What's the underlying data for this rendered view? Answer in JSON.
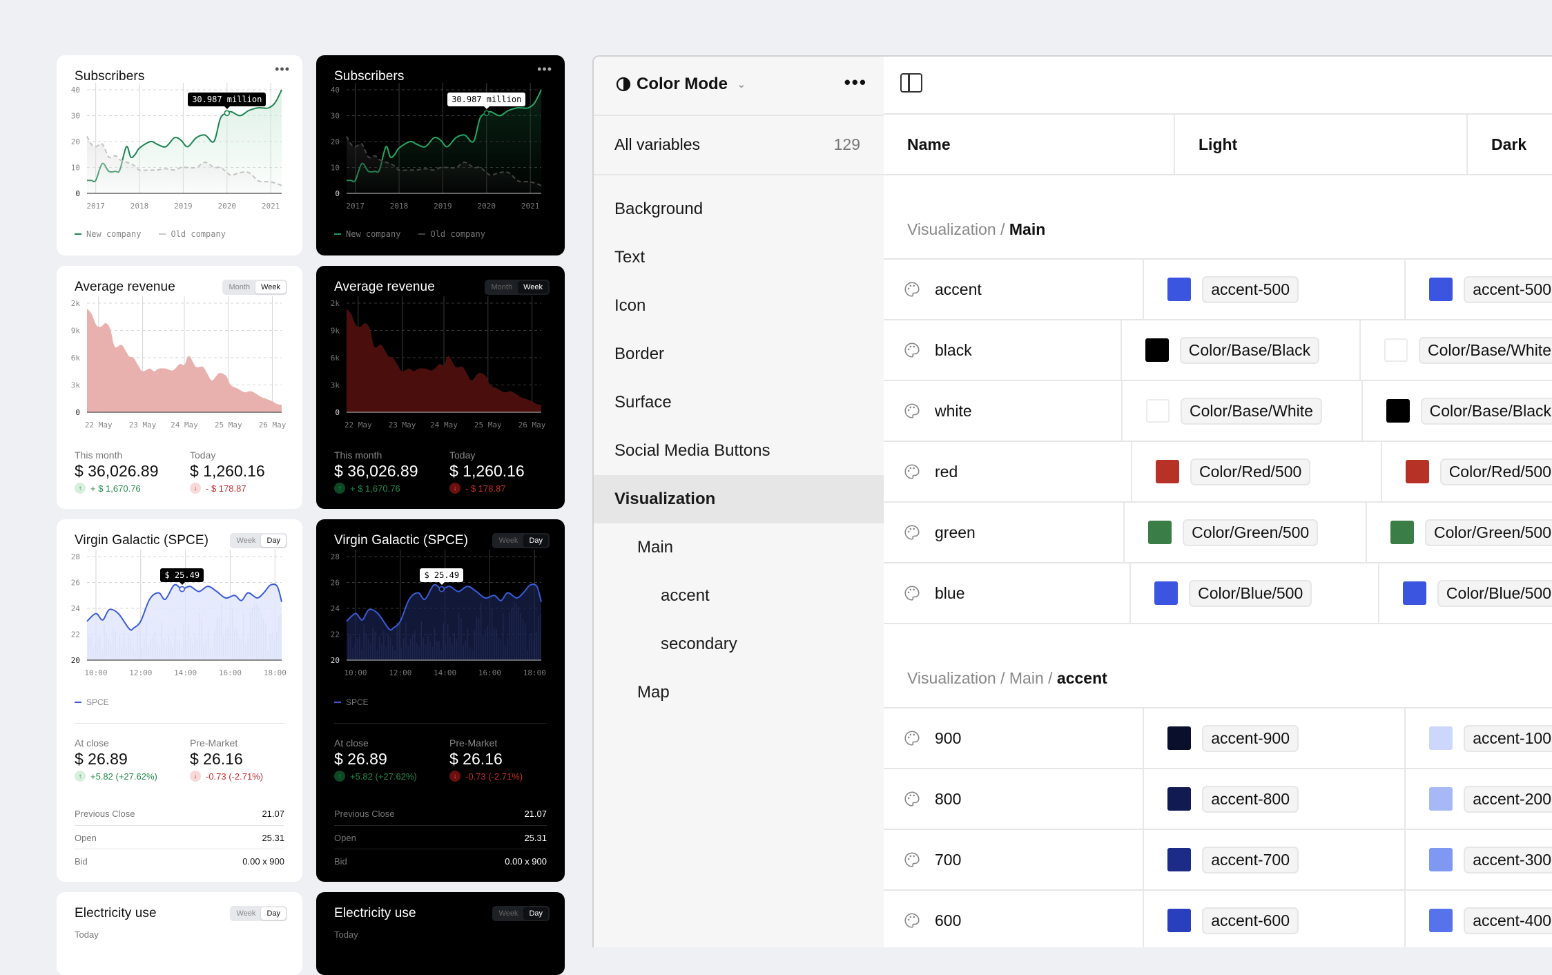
{
  "cards": {
    "subscribers": {
      "title": "Subscribers",
      "more": "•••",
      "tooltip": "30.987 million",
      "legend": [
        "New company",
        "Old company"
      ]
    },
    "revenue": {
      "title": "Average revenue",
      "segments": [
        "Month",
        "Week"
      ],
      "active_segment": "Week",
      "stats": [
        {
          "label": "This month",
          "value": "$ 36,026.89",
          "change": "+ $ 1,670.76",
          "direction": "up"
        },
        {
          "label": "Today",
          "value": "$ 1,260.16",
          "change": "- $ 178.87",
          "direction": "down"
        }
      ]
    },
    "spce": {
      "title": "Virgin Galactic (SPCE)",
      "segments": [
        "Week",
        "Day"
      ],
      "active_segment": "Day",
      "tooltip": "$ 25.49",
      "legend": [
        "SPCE"
      ],
      "stats": [
        {
          "label": "At close",
          "value": "$ 26.89",
          "change": "+5.82 (+27.62%)",
          "direction": "up"
        },
        {
          "label": "Pre-Market",
          "value": "$ 26.16",
          "change": "-0.73 (-2.71%)",
          "direction": "down"
        }
      ],
      "details": [
        {
          "key": "Previous Close",
          "value": "21.07"
        },
        {
          "key": "Open",
          "value": "25.31"
        },
        {
          "key": "Bid",
          "value": "0.00 x 900"
        }
      ]
    },
    "electricity": {
      "title": "Electricity use",
      "segments": [
        "Week",
        "Day"
      ],
      "active_segment": "Day",
      "subtitle": "Today"
    }
  },
  "chart_data": [
    {
      "id": "subscribers",
      "type": "line",
      "title": "Subscribers",
      "x": [
        2016.8,
        2016.9,
        2017.0,
        2017.15,
        2017.3,
        2017.45,
        2017.55,
        2017.7,
        2017.8,
        2017.9,
        2018.0,
        2018.25,
        2018.4,
        2018.6,
        2018.8,
        2018.95,
        2019.1,
        2019.3,
        2019.5,
        2019.7,
        2019.85,
        2020.0,
        2020.1,
        2020.3,
        2020.5,
        2020.7,
        2020.8,
        2020.95,
        2021.1,
        2021.25
      ],
      "series": [
        {
          "name": "New company",
          "color": "#1a8550",
          "values": [
            5,
            5,
            5,
            11.5,
            8.5,
            8.5,
            9,
            18,
            14,
            15,
            17.5,
            20,
            19,
            18,
            21.5,
            20.5,
            18,
            21.5,
            22.5,
            20,
            29,
            31,
            31.5,
            30,
            32,
            33,
            33,
            33,
            35,
            40
          ]
        },
        {
          "name": "Old company",
          "color": "#bdbdbd",
          "values": [
            22,
            19,
            18,
            19,
            14,
            14.5,
            13,
            12,
            11.5,
            10.5,
            9,
            9,
            9,
            9.5,
            9,
            10,
            10,
            10,
            12,
            10,
            10,
            8,
            7,
            8,
            8,
            5,
            4.5,
            4.5,
            4,
            3
          ]
        }
      ],
      "xticks": [
        "2017",
        "2018",
        "2019",
        "2020",
        "2021"
      ],
      "yticks": [
        "0",
        "10",
        "20",
        "30",
        "40"
      ],
      "ylim": [
        0,
        40
      ],
      "annotation": {
        "x": 2020.0,
        "y": 30.987,
        "label": "30.987 million"
      }
    },
    {
      "id": "revenue",
      "type": "area",
      "title": "Average revenue",
      "x": [
        0,
        0.1,
        0.2,
        0.3,
        0.4,
        0.5,
        0.6,
        0.75,
        0.9,
        1.0,
        1.1,
        1.2,
        1.35,
        1.45,
        1.55,
        1.7,
        1.85,
        2.0,
        2.1,
        2.2,
        2.35,
        2.5,
        2.6,
        2.7,
        2.85,
        3.0,
        3.1,
        3.25,
        3.4,
        3.55,
        3.75,
        3.85,
        4.0,
        4.1,
        4.2
      ],
      "series": [
        {
          "name": "Revenue",
          "color": "#e8b1ad",
          "values": [
            11.4,
            10.8,
            9.6,
            9.4,
            9.8,
            9.2,
            7.2,
            7.4,
            6.2,
            6.0,
            5.2,
            4.5,
            4.8,
            4.5,
            4.8,
            4.8,
            4.6,
            5.3,
            5.2,
            6.2,
            5.0,
            5.0,
            4.2,
            3.5,
            4.3,
            4.0,
            3.0,
            2.6,
            2.2,
            2.3,
            1.7,
            1.5,
            1.2,
            0.9,
            0.8
          ]
        }
      ],
      "xticks": [
        "22 May",
        "23 May",
        "24 May",
        "25 May",
        "26 May"
      ],
      "yticks": [
        "0",
        "3k",
        "6k",
        "9k",
        "2k"
      ],
      "ylim": [
        0,
        12
      ]
    },
    {
      "id": "spce",
      "type": "line",
      "title": "Virgin Galactic (SPCE)",
      "x": [
        9.6,
        10.0,
        10.3,
        10.6,
        11.0,
        11.5,
        11.7,
        12.0,
        12.4,
        12.8,
        13.1,
        13.5,
        13.85,
        14.2,
        14.6,
        15.0,
        15.4,
        15.8,
        16.2,
        16.5,
        16.8,
        17.2,
        17.5,
        17.8,
        18.1,
        18.3
      ],
      "series": [
        {
          "name": "SPCE",
          "color": "#3a5bd9",
          "values": [
            23.0,
            23.6,
            23.1,
            23.9,
            23.6,
            22.4,
            22.5,
            23.0,
            24.7,
            25.2,
            24.7,
            25.8,
            25.49,
            25.7,
            25.3,
            25.7,
            25.3,
            24.8,
            25.0,
            24.6,
            25.2,
            24.8,
            25.2,
            25.8,
            25.7,
            24.5
          ]
        }
      ],
      "xticks": [
        "10:00",
        "12:00",
        "14:00",
        "16:00",
        "18:00"
      ],
      "yticks": [
        "20",
        "22",
        "24",
        "26",
        "28"
      ],
      "ylim": [
        20,
        28
      ],
      "annotation": {
        "x": 13.85,
        "y": 25.49,
        "label": "$ 25.49"
      }
    }
  ],
  "variables": {
    "collection": "Color Mode",
    "more": "•••",
    "all_label": "All variables",
    "all_count": "129",
    "groups": [
      {
        "label": "Background",
        "level": 0
      },
      {
        "label": "Text",
        "level": 0
      },
      {
        "label": "Icon",
        "level": 0
      },
      {
        "label": "Border",
        "level": 0
      },
      {
        "label": "Surface",
        "level": 0
      },
      {
        "label": "Social Media Buttons",
        "level": 0
      },
      {
        "label": "Visualization",
        "level": 0,
        "active": true
      },
      {
        "label": "Main",
        "level": 1
      },
      {
        "label": "accent",
        "level": 2
      },
      {
        "label": "secondary",
        "level": 2
      },
      {
        "label": "Map",
        "level": 1
      }
    ],
    "columns": [
      "Name",
      "Light",
      "Dark"
    ],
    "sections": [
      {
        "path": "Visualization / ",
        "leaf": "Main",
        "rows": [
          {
            "name": "accent",
            "light_color": "#3b55e0",
            "light_alias": "accent-500",
            "dark_color": "#3b55e0",
            "dark_alias": "accent-500"
          },
          {
            "name": "black",
            "light_color": "#000000",
            "light_alias": "Color/Base/Black",
            "dark_color": "#ffffff",
            "dark_alias": "Color/Base/White"
          },
          {
            "name": "white",
            "light_color": "#ffffff",
            "light_alias": "Color/Base/White",
            "dark_color": "#000000",
            "dark_alias": "Color/Base/Black"
          },
          {
            "name": "red",
            "light_color": "#b63227",
            "light_alias": "Color/Red/500",
            "dark_color": "#b63227",
            "dark_alias": "Color/Red/500"
          },
          {
            "name": "green",
            "light_color": "#3a7d46",
            "light_alias": "Color/Green/500",
            "dark_color": "#3a7d46",
            "dark_alias": "Color/Green/500"
          },
          {
            "name": "blue",
            "light_color": "#3b55e0",
            "light_alias": "Color/Blue/500",
            "dark_color": "#3b55e0",
            "dark_alias": "Color/Blue/500"
          }
        ]
      },
      {
        "path": "Visualization / Main / ",
        "leaf": "accent",
        "rows": [
          {
            "name": "900",
            "light_color": "#0a0f2b",
            "light_alias": "accent-900",
            "dark_color": "#ccd7fb",
            "dark_alias": "accent-100"
          },
          {
            "name": "800",
            "light_color": "#121a52",
            "light_alias": "accent-800",
            "dark_color": "#a6b9f6",
            "dark_alias": "accent-200"
          },
          {
            "name": "700",
            "light_color": "#1c2a88",
            "light_alias": "accent-700",
            "dark_color": "#7f98f1",
            "dark_alias": "accent-300"
          },
          {
            "name": "600",
            "light_color": "#2a3fbd",
            "light_alias": "accent-600",
            "dark_color": "#5673ec",
            "dark_alias": "accent-400"
          }
        ]
      }
    ]
  }
}
